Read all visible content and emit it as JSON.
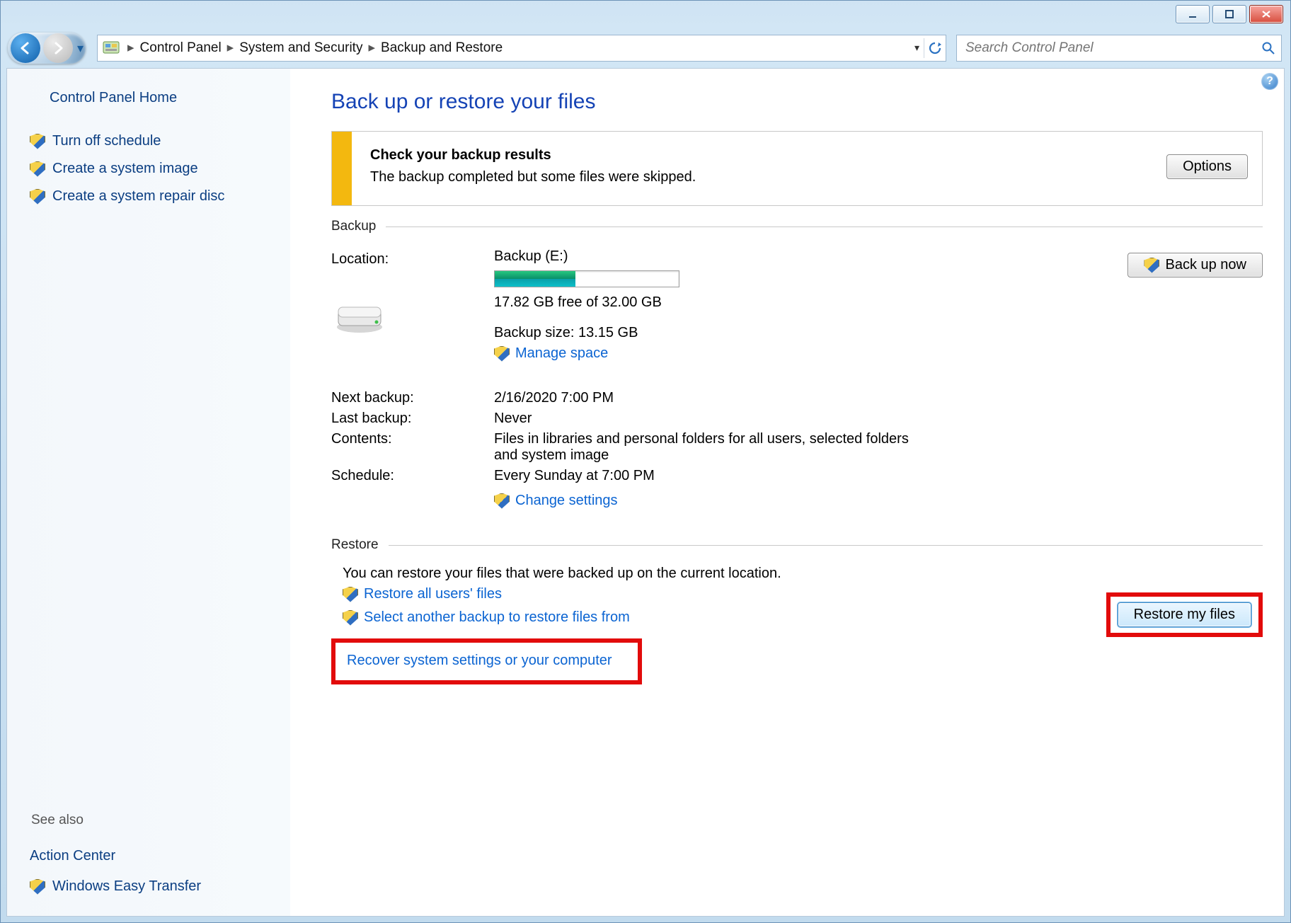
{
  "window": {
    "minimize": "",
    "maximize": "",
    "close": ""
  },
  "breadcrumb": {
    "seg1": "Control Panel",
    "seg2": "System and Security",
    "seg3": "Backup and Restore"
  },
  "search": {
    "placeholder": "Search Control Panel"
  },
  "sidebar": {
    "home": "Control Panel Home",
    "links": [
      "Turn off schedule",
      "Create a system image",
      "Create a system repair disc"
    ],
    "see_also_label": "See also",
    "see_also": [
      "Action Center",
      "Windows Easy Transfer"
    ]
  },
  "page": {
    "title": "Back up or restore your files",
    "notice_title": "Check your backup results",
    "notice_body": "The backup completed but some files were skipped.",
    "options_btn": "Options",
    "section_backup": "Backup",
    "location_label": "Location:",
    "location_value": "Backup (E:)",
    "disk_free": "17.82 GB free of 32.00 GB",
    "backup_size": "Backup size: 13.15 GB",
    "manage_space": "Manage space",
    "backup_now": "Back up now",
    "next_backup_label": "Next backup:",
    "next_backup_value": "2/16/2020 7:00 PM",
    "last_backup_label": "Last backup:",
    "last_backup_value": "Never",
    "contents_label": "Contents:",
    "contents_value": "Files in libraries and personal folders for all users, selected folders and system image",
    "schedule_label": "Schedule:",
    "schedule_value": "Every Sunday at 7:00 PM",
    "change_settings": "Change settings",
    "section_restore": "Restore",
    "restore_text": "You can restore your files that were backed up on the current location.",
    "restore_all": "Restore all users' files",
    "select_another": "Select another backup to restore files from",
    "restore_btn": "Restore my files",
    "recover_link": "Recover system settings or your computer"
  },
  "progress_pct": 44
}
